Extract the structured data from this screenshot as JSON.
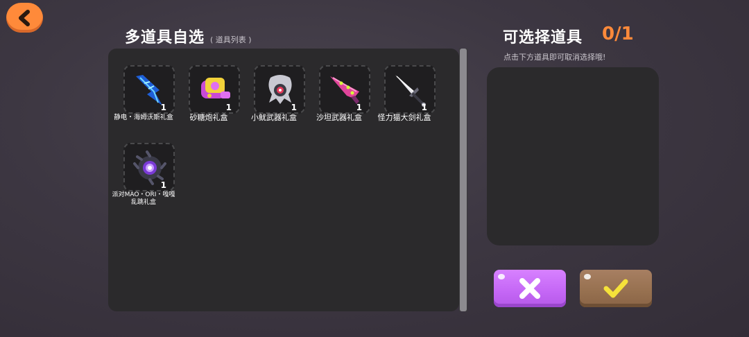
{
  "header": {
    "back_icon": "chevron-left-icon",
    "title": "多道具自选",
    "subtitle": "( 道具列表 )"
  },
  "items": [
    {
      "name": "静电・海姆沃斯礼盒",
      "count": "1",
      "icon": "electric-blade-icon"
    },
    {
      "name": "砂糖炮礼盒",
      "count": "1",
      "icon": "sugar-cannon-icon"
    },
    {
      "name": "小鱿武器礼盒",
      "count": "1",
      "icon": "squid-weapon-icon"
    },
    {
      "name": "沙坦武器礼盒",
      "count": "1",
      "icon": "pink-blade-icon"
    },
    {
      "name": "怪力猫大剑礼盒",
      "count": "1",
      "icon": "greatsword-icon"
    },
    {
      "name": "派对MAO・ORI・嘎嘎乱跳礼盒",
      "count": "1",
      "icon": "party-orb-icon"
    }
  ],
  "selection": {
    "title": "可选择道具",
    "count": "0/1",
    "hint": "点击下方道具即可取消选择哦!"
  },
  "buttons": {
    "cancel_icon": "close-icon",
    "confirm_icon": "checkmark-icon"
  },
  "colors": {
    "accent_orange": "#ff8a3a",
    "cancel_purple": "#c466f5",
    "confirm_brown": "#96704f"
  }
}
